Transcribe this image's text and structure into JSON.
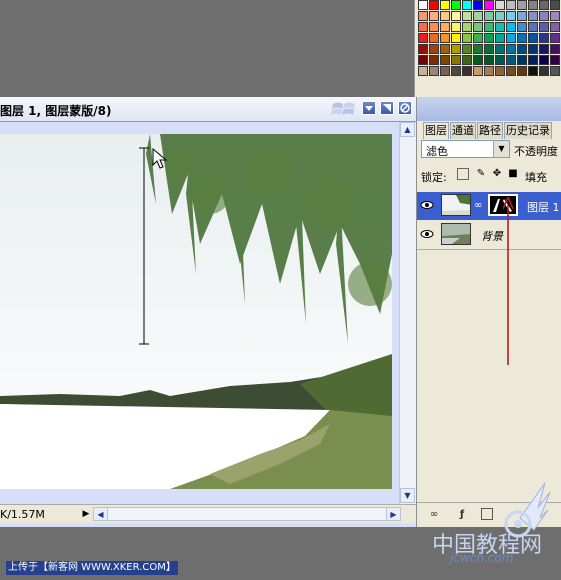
{
  "document": {
    "title": "图层 1, 图层蒙版/8)",
    "status_size": "K/1.57M"
  },
  "layers_panel": {
    "tabs": [
      "图层",
      "通道",
      "路径",
      "历史记录"
    ],
    "blend_mode": "滤色",
    "opacity_label": "不透明度",
    "lock_label": "锁定:",
    "fill_label": "填充",
    "layers": [
      {
        "name": "图层 1",
        "selected": true
      },
      {
        "name": "背景",
        "selected": false
      }
    ]
  },
  "swatch_colors": [
    [
      "#ffffff",
      "#ff0000",
      "#ffff00",
      "#00ff00",
      "#00ffff",
      "#0000ff",
      "#ff00ff",
      "#d8d8d8",
      "#bcbcbc",
      "#a0a0a0",
      "#848484",
      "#686868",
      "#4c4c4c"
    ],
    [
      "#f7977a",
      "#f9ad81",
      "#fdc68a",
      "#fff79a",
      "#c4df9b",
      "#a2d39c",
      "#82ca9d",
      "#7bcdc8",
      "#6ecff6",
      "#7ea7d8",
      "#8493ca",
      "#8882be",
      "#a187be"
    ],
    [
      "#f26c4f",
      "#f68e55",
      "#fbaf5c",
      "#fff467",
      "#acd372",
      "#7cc576",
      "#3bb878",
      "#1abbb4",
      "#00bff3",
      "#438cca",
      "#5574b9",
      "#605ca8",
      "#855fa8"
    ],
    [
      "#ed1c24",
      "#f26522",
      "#f7941d",
      "#fff200",
      "#8dc73f",
      "#39b54a",
      "#00a651",
      "#00a99d",
      "#00aeef",
      "#0072bc",
      "#0054a6",
      "#2e3192",
      "#662d91"
    ],
    [
      "#9e0b0f",
      "#a0410d",
      "#a36209",
      "#aba000",
      "#598527",
      "#1a7b30",
      "#007236",
      "#00746b",
      "#0076a3",
      "#004b80",
      "#003471",
      "#1b1464",
      "#440e62"
    ],
    [
      "#790000",
      "#7b2e00",
      "#7d4900",
      "#827b00",
      "#406618",
      "#005e20",
      "#005826",
      "#005952",
      "#005b7f",
      "#003663",
      "#002157",
      "#0d004c",
      "#32004b"
    ],
    [
      "#c7b299",
      "#998675",
      "#736357",
      "#534741",
      "#37302d",
      "#c69c6d",
      "#a67c52",
      "#8c6239",
      "#754c24",
      "#603913",
      "#111111",
      "#333333",
      "#555555"
    ]
  ],
  "footer": {
    "upload_note": "上传于【新客网 WWW.XKER.COM】",
    "site_mark": "中国教程网",
    "site_url": "jcwcn.com"
  },
  "icons": [
    "window-logo-icon",
    "minimize-icon",
    "restore-icon",
    "close-icon",
    "eye-icon",
    "link-icon",
    "lock-transparency-icon",
    "lock-brush-icon",
    "lock-move-icon",
    "lock-all-icon",
    "cursor-icon",
    "red-arrow-icon",
    "link-layers-icon",
    "layer-style-icon",
    "mask-icon",
    "wings-logo-icon"
  ]
}
